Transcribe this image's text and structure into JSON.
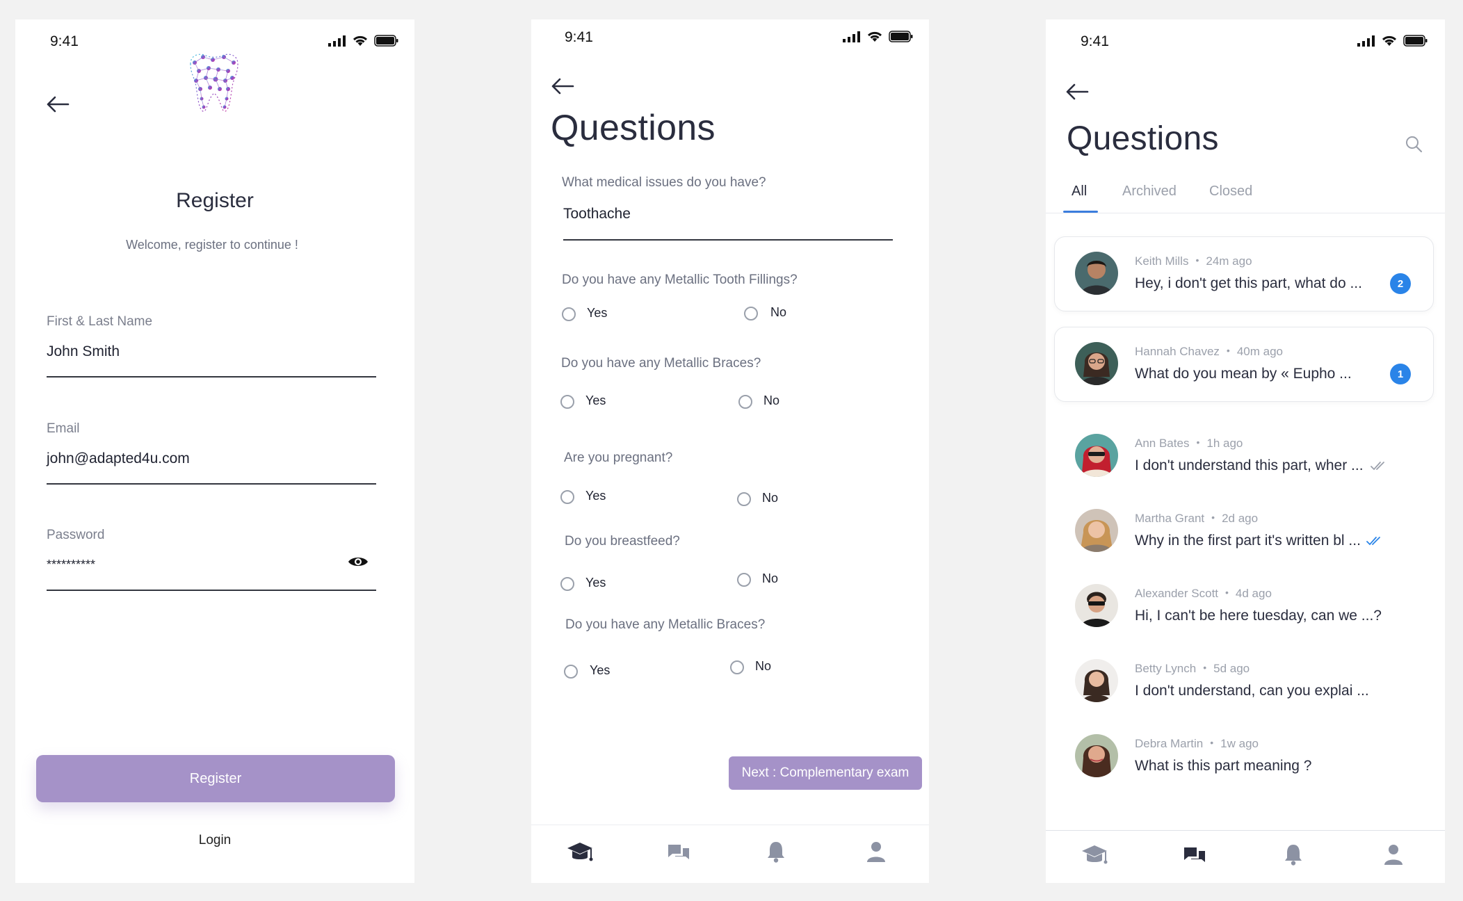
{
  "status_bar": {
    "time": "9:41"
  },
  "register_screen": {
    "title": "Register",
    "subtitle": "Welcome, register to continue !",
    "fields": [
      {
        "label": "First & Last Name",
        "value": "John Smith"
      },
      {
        "label": "Email",
        "value": "john@adapted4u.com"
      },
      {
        "label": "Password",
        "value": "**********"
      }
    ],
    "register_button": "Register",
    "login_link": "Login"
  },
  "questions_form_screen": {
    "title": "Questions",
    "text_question": {
      "label": "What medical issues do you have?",
      "value": "Toothache"
    },
    "radio_questions": [
      {
        "label": "Do you have any Metallic Tooth Fillings?",
        "yes": "Yes",
        "no": "No"
      },
      {
        "label": "Do you have any Metallic Braces?",
        "yes": "Yes",
        "no": "No"
      },
      {
        "label": "Are you pregnant?",
        "yes": "Yes",
        "no": "No"
      },
      {
        "label": "Do you breastfeed?",
        "yes": "Yes",
        "no": "No"
      },
      {
        "label": "Do you have any Metallic Braces?",
        "yes": "Yes",
        "no": "No"
      }
    ],
    "next_button": "Next : Complementary exam"
  },
  "questions_list_screen": {
    "title": "Questions",
    "tabs": [
      "All",
      "Archived",
      "Closed"
    ],
    "active_tab": "All",
    "messages": [
      {
        "name": "Keith Mills",
        "time": "24m ago",
        "preview": "Hey, i don't get this part, what do ...",
        "badge": "2",
        "status": "unread"
      },
      {
        "name": "Hannah Chavez",
        "time": "40m ago",
        "preview": "What do you mean by « Eupho ...",
        "badge": "1",
        "status": "unread"
      },
      {
        "name": "Ann Bates",
        "time": "1h ago",
        "preview": "I don't understand this part, wher ...",
        "status": "delivered"
      },
      {
        "name": "Martha Grant",
        "time": "2d ago",
        "preview": "Why in the first part it's written bl ...",
        "status": "read"
      },
      {
        "name": "Alexander Scott",
        "time": "4d ago",
        "preview": "Hi, I can't be here tuesday, can we ...?",
        "status": "none"
      },
      {
        "name": "Betty Lynch",
        "time": "5d ago",
        "preview": "I don't understand, can you explai ...",
        "status": "none"
      },
      {
        "name": "Debra Martin",
        "time": "1w ago",
        "preview": "What is this part meaning ?",
        "status": "none"
      }
    ]
  },
  "tabbar_icons": [
    "graduation-cap-icon",
    "chat-bubbles-icon",
    "bell-icon",
    "user-icon"
  ],
  "colors": {
    "accent": "#a592c8",
    "badge": "#2a84e8",
    "read_check": "#2a84e8",
    "text": "#2a2d3e",
    "muted": "#9ba0ab"
  }
}
